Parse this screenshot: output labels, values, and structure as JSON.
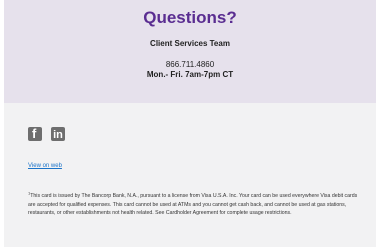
{
  "header": {
    "title": "Questions?",
    "team": "Client Services Team",
    "phone": "866.711.4860",
    "hours": "Mon.- Fri. 7am-7pm CT"
  },
  "social": [
    {
      "icon": "facebook-icon",
      "glyph": "f"
    },
    {
      "icon": "linkedin-icon",
      "glyph": "in"
    }
  ],
  "links": {
    "view_on_web": "View on web"
  },
  "footer": {
    "footnote_mark": "1",
    "disclaimer": "This card is issued by The Bancorp Bank, N.A., pursuant to a license from Visa U.S.A. Inc. Your card can be used everywhere Visa debit cards are accepted for qualified expenses. This card cannot be used at ATMs and you cannot get cash back, and cannot be used at gas stations, restaurants, or other establishments not health related. See Cardholder Agreement for complete usage restrictions."
  },
  "colors": {
    "accent": "#5a2d91",
    "header_bg": "#e6e1ec",
    "footer_bg": "#f2f2f3",
    "link": "#1a73c8"
  }
}
